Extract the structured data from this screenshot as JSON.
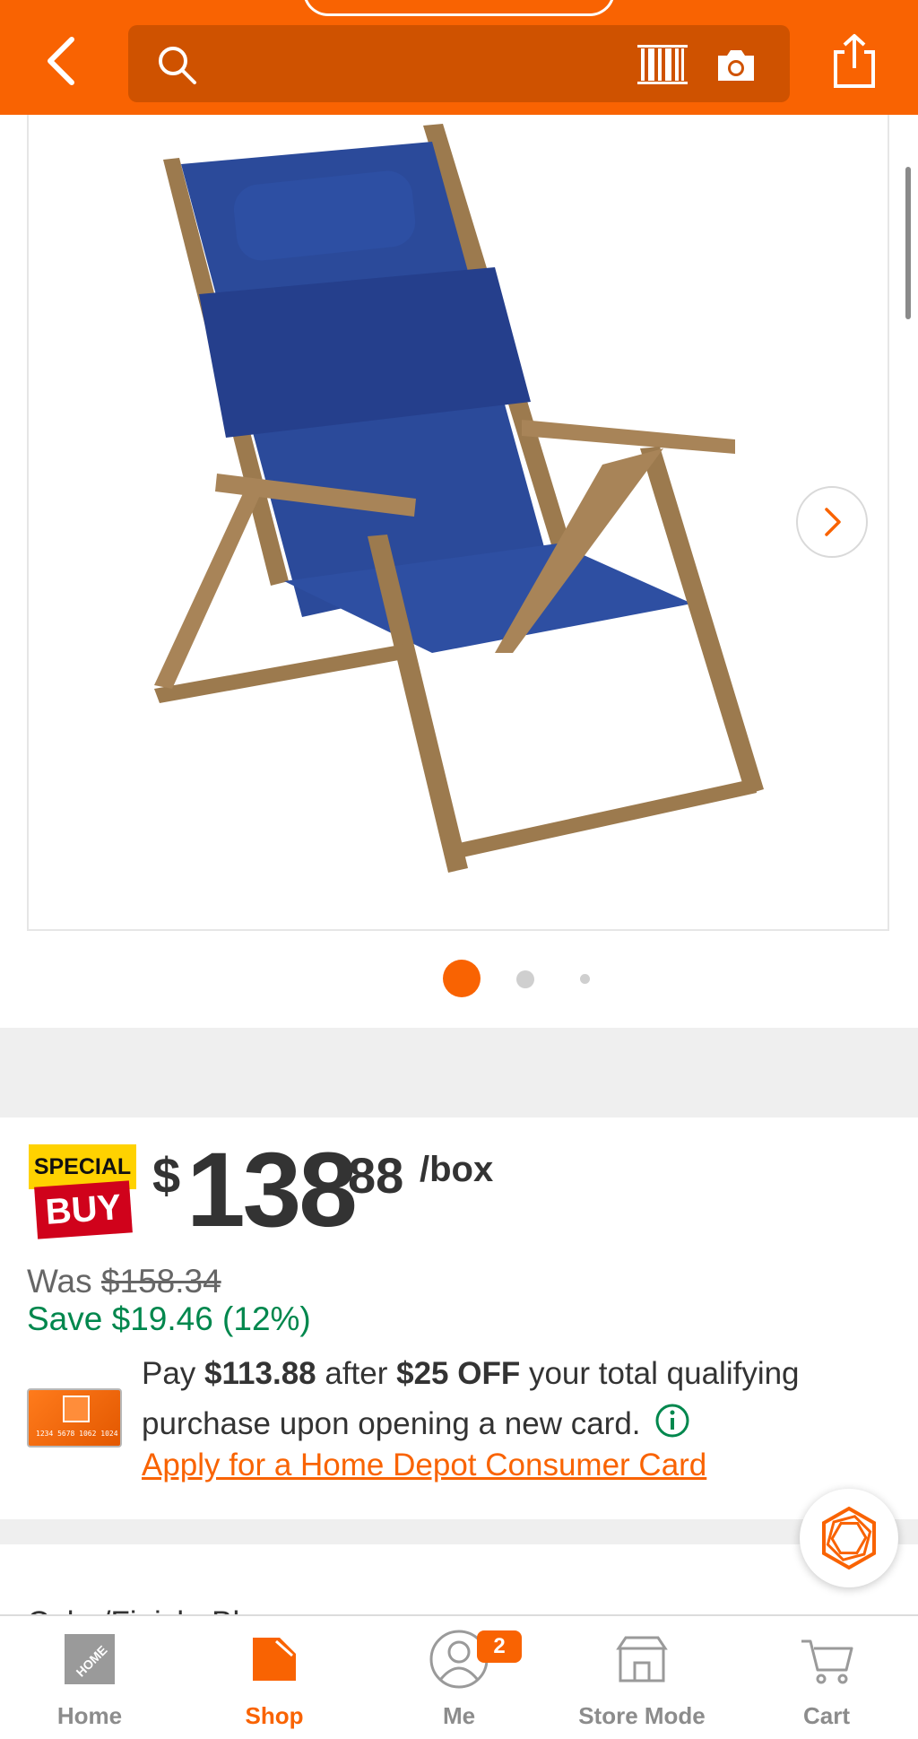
{
  "header": {
    "search_placeholder": "",
    "icons": [
      "back-arrow-icon",
      "search-icon",
      "barcode-icon",
      "camera-icon",
      "share-icon"
    ],
    "color": "#f96302"
  },
  "gallery": {
    "image": "blue beach chair with wood frame",
    "total_images": 3,
    "active_index": 1
  },
  "price": {
    "badge_top": "SPECIAL",
    "badge_bottom": "BUY",
    "currency": "$",
    "dollars": "138",
    "cents": "88",
    "unit": "/box",
    "was_label": "Was",
    "was_price": "$158.34",
    "save_text": "Save $19.46 (12%)"
  },
  "offer": {
    "pre1": "Pay ",
    "amount": "$113.88",
    "mid": " after ",
    "discount": "$25 OFF",
    "post": " your total qualifying purchase upon opening a new card.",
    "link": "Apply for a Home Depot Consumer Card",
    "card_number": "1234 5678 1062 1024"
  },
  "next_section_partial": "Color/Finish: Bl",
  "bottom_nav": {
    "items": [
      {
        "label": "Home",
        "icon": "home-depot-logo-icon"
      },
      {
        "label": "Shop",
        "icon": "shop-tag-icon"
      },
      {
        "label": "Me",
        "icon": "user-icon",
        "badge": "2"
      },
      {
        "label": "Store Mode",
        "icon": "store-icon"
      },
      {
        "label": "Cart",
        "icon": "cart-icon"
      }
    ],
    "active": "Shop"
  },
  "colors": {
    "brand_orange": "#f96302",
    "save_green": "#00874d",
    "badge_yellow": "#ffd200",
    "badge_red": "#d0021b"
  }
}
